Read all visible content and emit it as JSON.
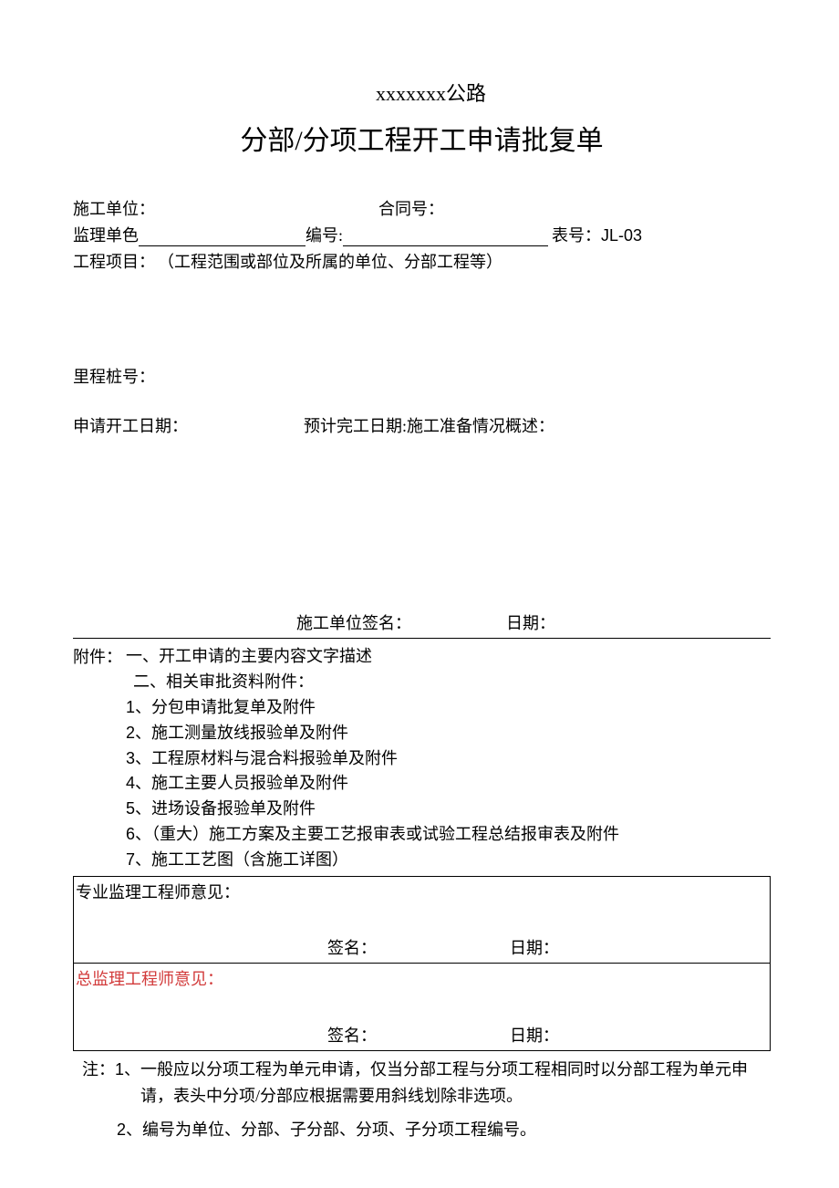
{
  "header": {
    "line1": "xxxxxxx公路",
    "line2": "分部/分项工程开工申请批复单"
  },
  "meta": {
    "construction_unit_label": "施工单位：",
    "contract_no_label": "合同号：",
    "supervision_unit_label": "监理单色",
    "serial_no_label": "编号:",
    "form_no_label_cn": "表号：",
    "form_no_value": "JL-03"
  },
  "project": {
    "label": "工程项目：",
    "desc": "（工程范围或部位及所属的单位、分部工程等）"
  },
  "stake": {
    "label": "里程桩号："
  },
  "dates": {
    "apply_label": "申请开工日期：",
    "estimate_label": "预计完工日期:施工准备情况概述："
  },
  "sign": {
    "unit_label": "施工单位签名：",
    "date_label": "日期："
  },
  "attachments": {
    "label": "附件：",
    "item1": "一、开工申请的主要内容文字描述",
    "item2": "二、相关审批资料附件：",
    "sub": [
      "、分包申请批复单及附件",
      "、施工测量放线报验单及附件",
      "、工程原材料与混合料报验单及附件",
      "、施工主要人员报验单及附件",
      "、进场设备报验单及附件",
      "、（重大）施工方案及主要工艺报审表或试验工程总结报审表及附件",
      "、施工工艺图（含施工详图）"
    ]
  },
  "opinion": {
    "prof_label": "专业监理工程师意见：",
    "chief_label": "总监理工程师意见：",
    "sign_label": "签名：",
    "date_label": "日期："
  },
  "notes": {
    "prefix_cn": "注：",
    "num1": "1、",
    "text1": "一般应以分项工程为单元申请，仅当分部工程与分项工程相同时以分部工程为单元申请，表头中分项/分部应根据需要用斜线划除非选项。",
    "num2": "2、",
    "text2": "编号为单位、分部、子分部、分项、子分项工程编号。"
  }
}
